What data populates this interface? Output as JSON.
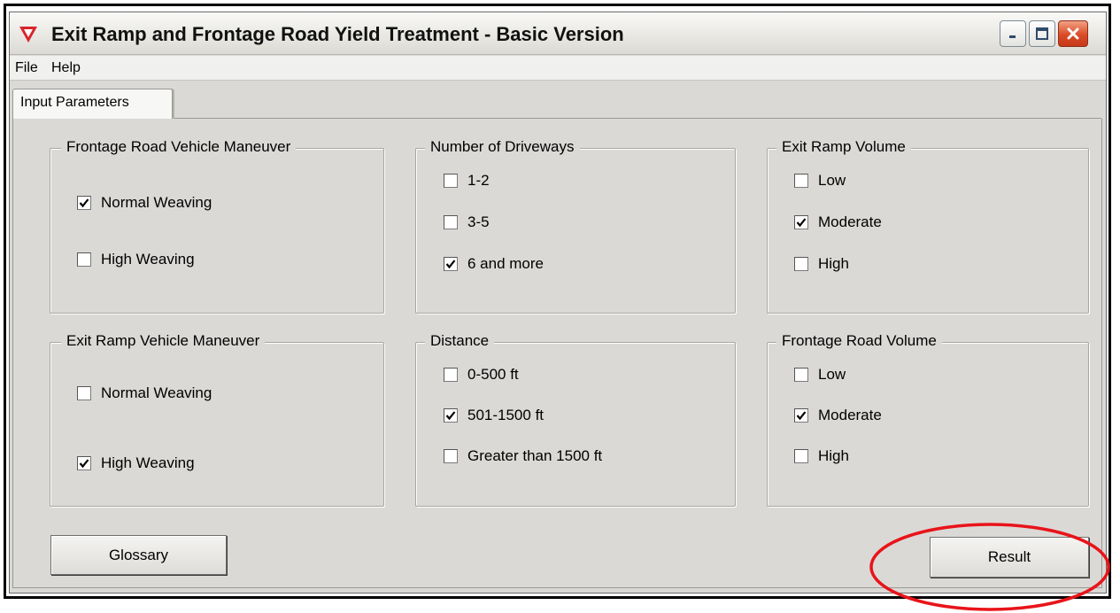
{
  "window": {
    "title": "Exit Ramp and Frontage Road Yield Treatment - Basic Version",
    "icon": "red-down-triangle-icon"
  },
  "menu": [
    "File",
    "Help"
  ],
  "tab": {
    "label": "Input Parameters"
  },
  "groups": [
    {
      "id": "frontage-road-vehicle-maneuver",
      "title": "Frontage Road Vehicle Maneuver",
      "options": [
        {
          "label": "Normal Weaving",
          "checked": true
        },
        {
          "label": "High Weaving",
          "checked": false
        }
      ]
    },
    {
      "id": "number-of-driveways",
      "title": "Number of Driveways",
      "options": [
        {
          "label": "1-2",
          "checked": false
        },
        {
          "label": "3-5",
          "checked": false
        },
        {
          "label": "6 and more",
          "checked": true
        }
      ]
    },
    {
      "id": "exit-ramp-volume",
      "title": "Exit Ramp Volume",
      "options": [
        {
          "label": "Low",
          "checked": false
        },
        {
          "label": "Moderate",
          "checked": true
        },
        {
          "label": "High",
          "checked": false
        }
      ]
    },
    {
      "id": "exit-ramp-vehicle-maneuver",
      "title": "Exit Ramp Vehicle Maneuver",
      "options": [
        {
          "label": "Normal Weaving",
          "checked": false
        },
        {
          "label": "High Weaving",
          "checked": true
        }
      ]
    },
    {
      "id": "distance",
      "title": "Distance",
      "options": [
        {
          "label": "0-500 ft",
          "checked": false
        },
        {
          "label": "501-1500 ft",
          "checked": true
        },
        {
          "label": "Greater than 1500 ft",
          "checked": false
        }
      ]
    },
    {
      "id": "frontage-road-volume",
      "title": "Frontage Road Volume",
      "options": [
        {
          "label": "Low",
          "checked": false
        },
        {
          "label": "Moderate",
          "checked": true
        },
        {
          "label": "High",
          "checked": false
        }
      ]
    }
  ],
  "buttons": {
    "glossary": "Glossary",
    "result": "Result"
  },
  "colors": {
    "annotation": "#e8141a",
    "close_button": "#d9462a",
    "app_icon": "#d8232a"
  }
}
